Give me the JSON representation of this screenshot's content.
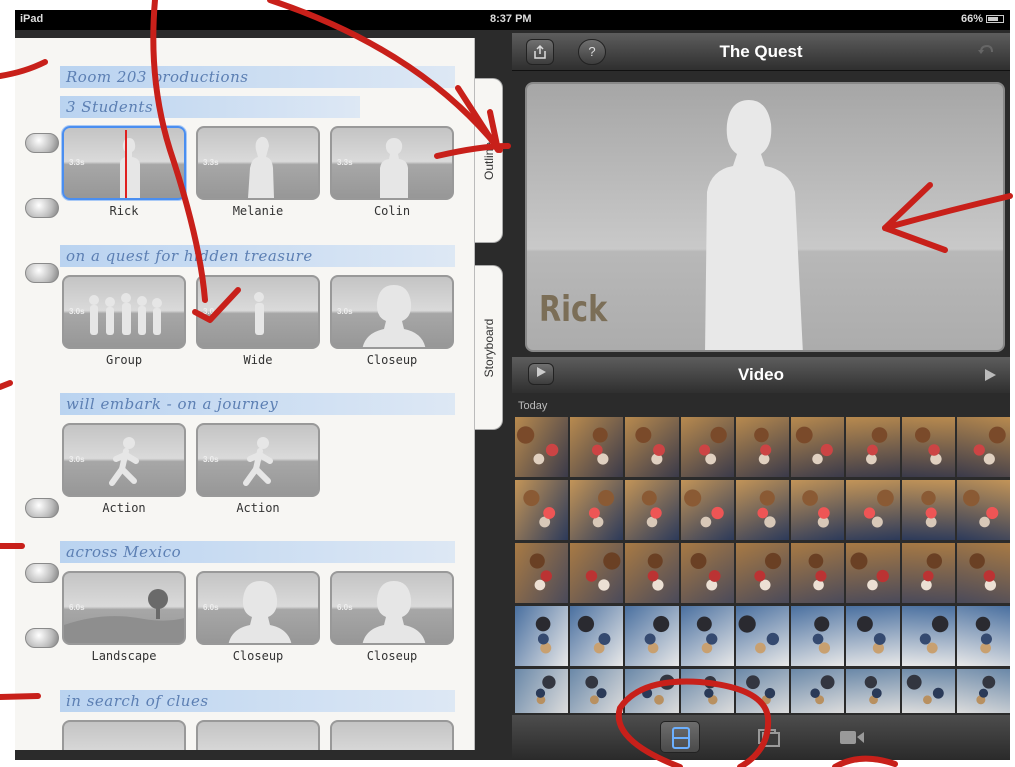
{
  "status_bar": {
    "device": "iPad",
    "time": "8:37 PM",
    "battery": "66%"
  },
  "notebook": {
    "sections": [
      {
        "heading_line1": "Room 203 productions",
        "heading_line2": "3 Students",
        "tiles": [
          {
            "label": "Rick",
            "duration": "3.3s",
            "shot": "medium",
            "selected": true
          },
          {
            "label": "Melanie",
            "duration": "3.3s",
            "shot": "medium-female",
            "selected": false
          },
          {
            "label": "Colin",
            "duration": "3.3s",
            "shot": "medium",
            "selected": false
          }
        ]
      },
      {
        "heading": "on a quest for hidden treasure",
        "tiles": [
          {
            "label": "Group",
            "duration": "3.0s",
            "shot": "group"
          },
          {
            "label": "Wide",
            "duration": "3.0s",
            "shot": "wide"
          },
          {
            "label": "Closeup",
            "duration": "3.0s",
            "shot": "closeup"
          }
        ]
      },
      {
        "heading": "will embark - on a journey",
        "tiles": [
          {
            "label": "Action",
            "duration": "3.0s",
            "shot": "action"
          },
          {
            "label": "Action",
            "duration": "3.0s",
            "shot": "action"
          }
        ]
      },
      {
        "heading": "across Mexico",
        "tiles": [
          {
            "label": "Landscape",
            "duration": "6.0s",
            "shot": "landscape"
          },
          {
            "label": "Closeup",
            "duration": "6.0s",
            "shot": "closeup"
          },
          {
            "label": "Closeup",
            "duration": "6.0s",
            "shot": "closeup"
          }
        ]
      },
      {
        "heading": "in search of clues",
        "tiles": []
      }
    ],
    "tabs": {
      "outline": "Outline",
      "storyboard": "Storyboard"
    }
  },
  "viewer": {
    "project_title": "The Quest",
    "title_card_name": "Rick",
    "share_icon": "share-icon",
    "help_icon": "help-icon",
    "help_glyph": "?",
    "rewind_icon": "rewind-icon"
  },
  "browser": {
    "title": "Video",
    "section_label": "Today"
  },
  "toolbar": {
    "buttons": [
      "storyboard-icon",
      "photos-icon",
      "camera-icon"
    ]
  },
  "colors": {
    "annotation_red": "#c8201a",
    "heading_blue": "#5c7fb3",
    "selection_blue": "#4a8ef0"
  }
}
